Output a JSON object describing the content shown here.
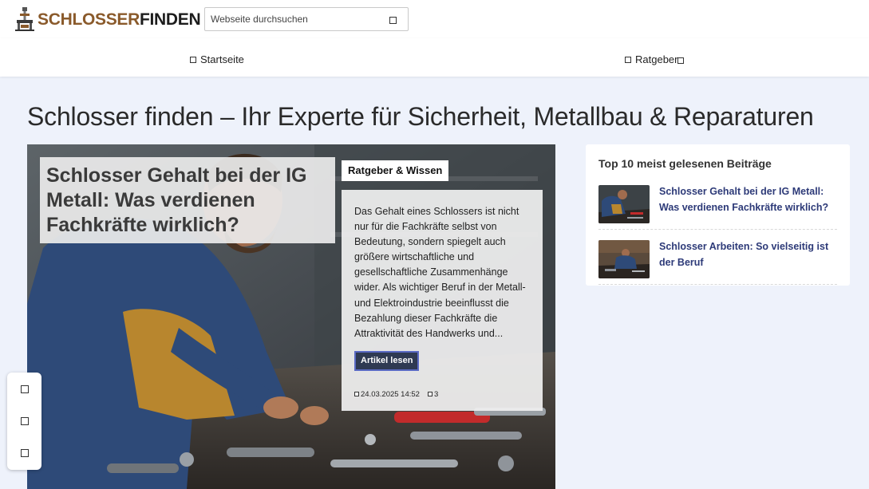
{
  "header": {
    "logo_part1": "SCHLOSSER",
    "logo_part2": "FINDEN",
    "search_placeholder": "Webseite durchsuchen",
    "search_icon": "search-icon"
  },
  "nav": {
    "items": [
      {
        "label": "Startseite",
        "icon": "home-icon"
      },
      {
        "label": "Ratgeber",
        "icon": "book-icon",
        "has_dropdown": true
      }
    ]
  },
  "page": {
    "title": "Schlosser finden – Ihr Experte für Sicherheit, Metallbau & Reparaturen"
  },
  "hero": {
    "title": "Schlosser Gehalt bei der IG Metall: Was verdienen Fachkräfte wirklich?",
    "category": "Ratgeber & Wissen",
    "excerpt": "Das Gehalt eines Schlossers ist nicht nur für die Fachkräfte selbst von Bedeutung, sondern spiegelt auch größere wirtschaftliche und gesellschaftliche Zusammenhänge wider. Als wichtiger Beruf in der Metall- und Elektroindustrie beeinflusst die Bezahlung dieser Fachkräfte die Attraktivität des Handwerks und...",
    "read_more": "Artikel lesen",
    "date": "24.03.2025 14:52",
    "comments": "3"
  },
  "float_actions": [
    "share-icon",
    "bookmark-icon",
    "print-icon"
  ],
  "sidebar": {
    "title": "Top 10 meist gelesenen Beiträge",
    "items": [
      {
        "title": "Schlosser Gehalt bei der IG Metall: Was verdienen Fachkräfte wirklich?"
      },
      {
        "title": "Schlosser Arbeiten: So vielseitig ist der Beruf"
      }
    ]
  },
  "colors": {
    "logo_accent": "#8a5a2b",
    "link": "#2d3a78",
    "button_bg": "#2f3a52",
    "page_bg": "#eef2fb"
  }
}
